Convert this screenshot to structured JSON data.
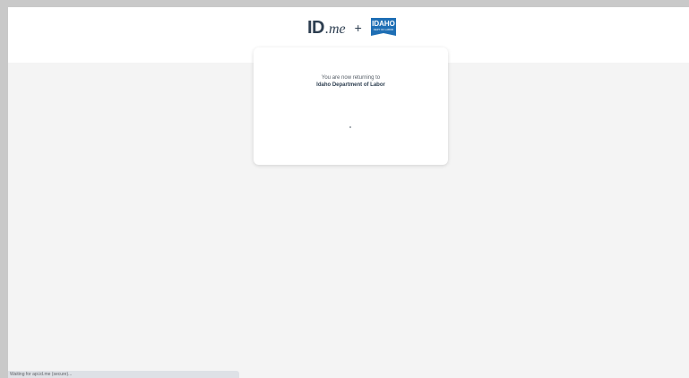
{
  "header": {
    "idme_logo": {
      "id_text": "ID",
      "me_text": ".me"
    },
    "plus_sign": "+",
    "partner_logo": {
      "line1": "IDAHO",
      "line2": "DEPT OF LABOR",
      "color": "#1f6fb5"
    }
  },
  "card": {
    "message": "You are now returning to",
    "destination": "Idaho Department of Labor"
  },
  "status_bar": {
    "text": "Waiting for api.id.me (secure)..."
  },
  "colors": {
    "brand_text": "#2e3f51",
    "page_background": "#f4f4f4",
    "header_background": "#ffffff"
  }
}
